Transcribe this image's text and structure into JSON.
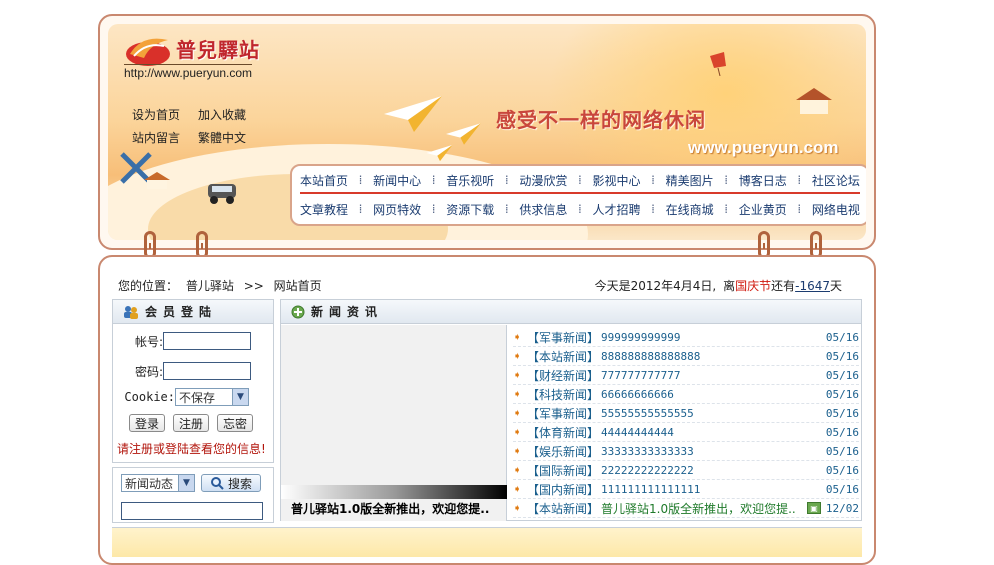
{
  "brand": {
    "name": "普兒驛站",
    "url": "http://www.pueryun.com"
  },
  "quick_links": [
    "设为首页",
    "加入收藏",
    "站内留言",
    "繁體中文"
  ],
  "banner": {
    "slogan": "感受不一样的网络休闲",
    "site_url": "www.pueryun.com"
  },
  "nav": {
    "row1": [
      "本站首页",
      "新闻中心",
      "音乐视听",
      "动漫欣赏",
      "影视中心",
      "精美图片",
      "博客日志",
      "社区论坛"
    ],
    "row2": [
      "文章教程",
      "网页特效",
      "资源下载",
      "供求信息",
      "人才招聘",
      "在线商城",
      "企业黄页",
      "网络电视"
    ],
    "separator": "⁞"
  },
  "breadcrumb": {
    "prefix": "您的位置：",
    "site": "普儿驿站",
    "sep": ">>",
    "current": "网站首页"
  },
  "date_line": {
    "today": "今天是2012年4月4日,",
    "away": "离",
    "holiday": "国庆节",
    "still": "还有",
    "days": "-1647",
    "unit": "天"
  },
  "login": {
    "title": "会员登陆",
    "account_label": "帐号:",
    "password_label": "密码:",
    "cookie_label": "Cookie:",
    "cookie_value": "不保存",
    "login_btn": "登录",
    "register_btn": "注册",
    "forgot_btn": "忘密",
    "tip": "请注册或登陆查看您的信息!"
  },
  "search": {
    "category": "新闻动态",
    "button": "搜索"
  },
  "news": {
    "title": "新闻资讯",
    "caption": "普儿驿站1.0版全新推出，欢迎您提..",
    "items": [
      {
        "cat": "【军事新闻】",
        "title": "999999999999",
        "date": "05/16"
      },
      {
        "cat": "【本站新闻】",
        "title": "888888888888888",
        "date": "05/16"
      },
      {
        "cat": "【财经新闻】",
        "title": "777777777777",
        "date": "05/16"
      },
      {
        "cat": "【科技新闻】",
        "title": "66666666666",
        "date": "05/16"
      },
      {
        "cat": "【军事新闻】",
        "title": "55555555555555",
        "date": "05/16"
      },
      {
        "cat": "【体育新闻】",
        "title": "44444444444",
        "date": "05/16"
      },
      {
        "cat": "【娱乐新闻】",
        "title": "33333333333333",
        "date": "05/16"
      },
      {
        "cat": "【国际新闻】",
        "title": "22222222222222",
        "date": "05/16"
      },
      {
        "cat": "【国内新闻】",
        "title": "111111111111111",
        "date": "05/16"
      },
      {
        "cat": "【本站新闻】",
        "title": "普儿驿站1.0版全新推出，欢迎您提..",
        "date": "12/02"
      }
    ]
  },
  "colors": {
    "frame": "#c9886f",
    "nav_text": "#1b3c70",
    "accent_red": "#d83a2b",
    "news_link": "#1a5f8d"
  }
}
